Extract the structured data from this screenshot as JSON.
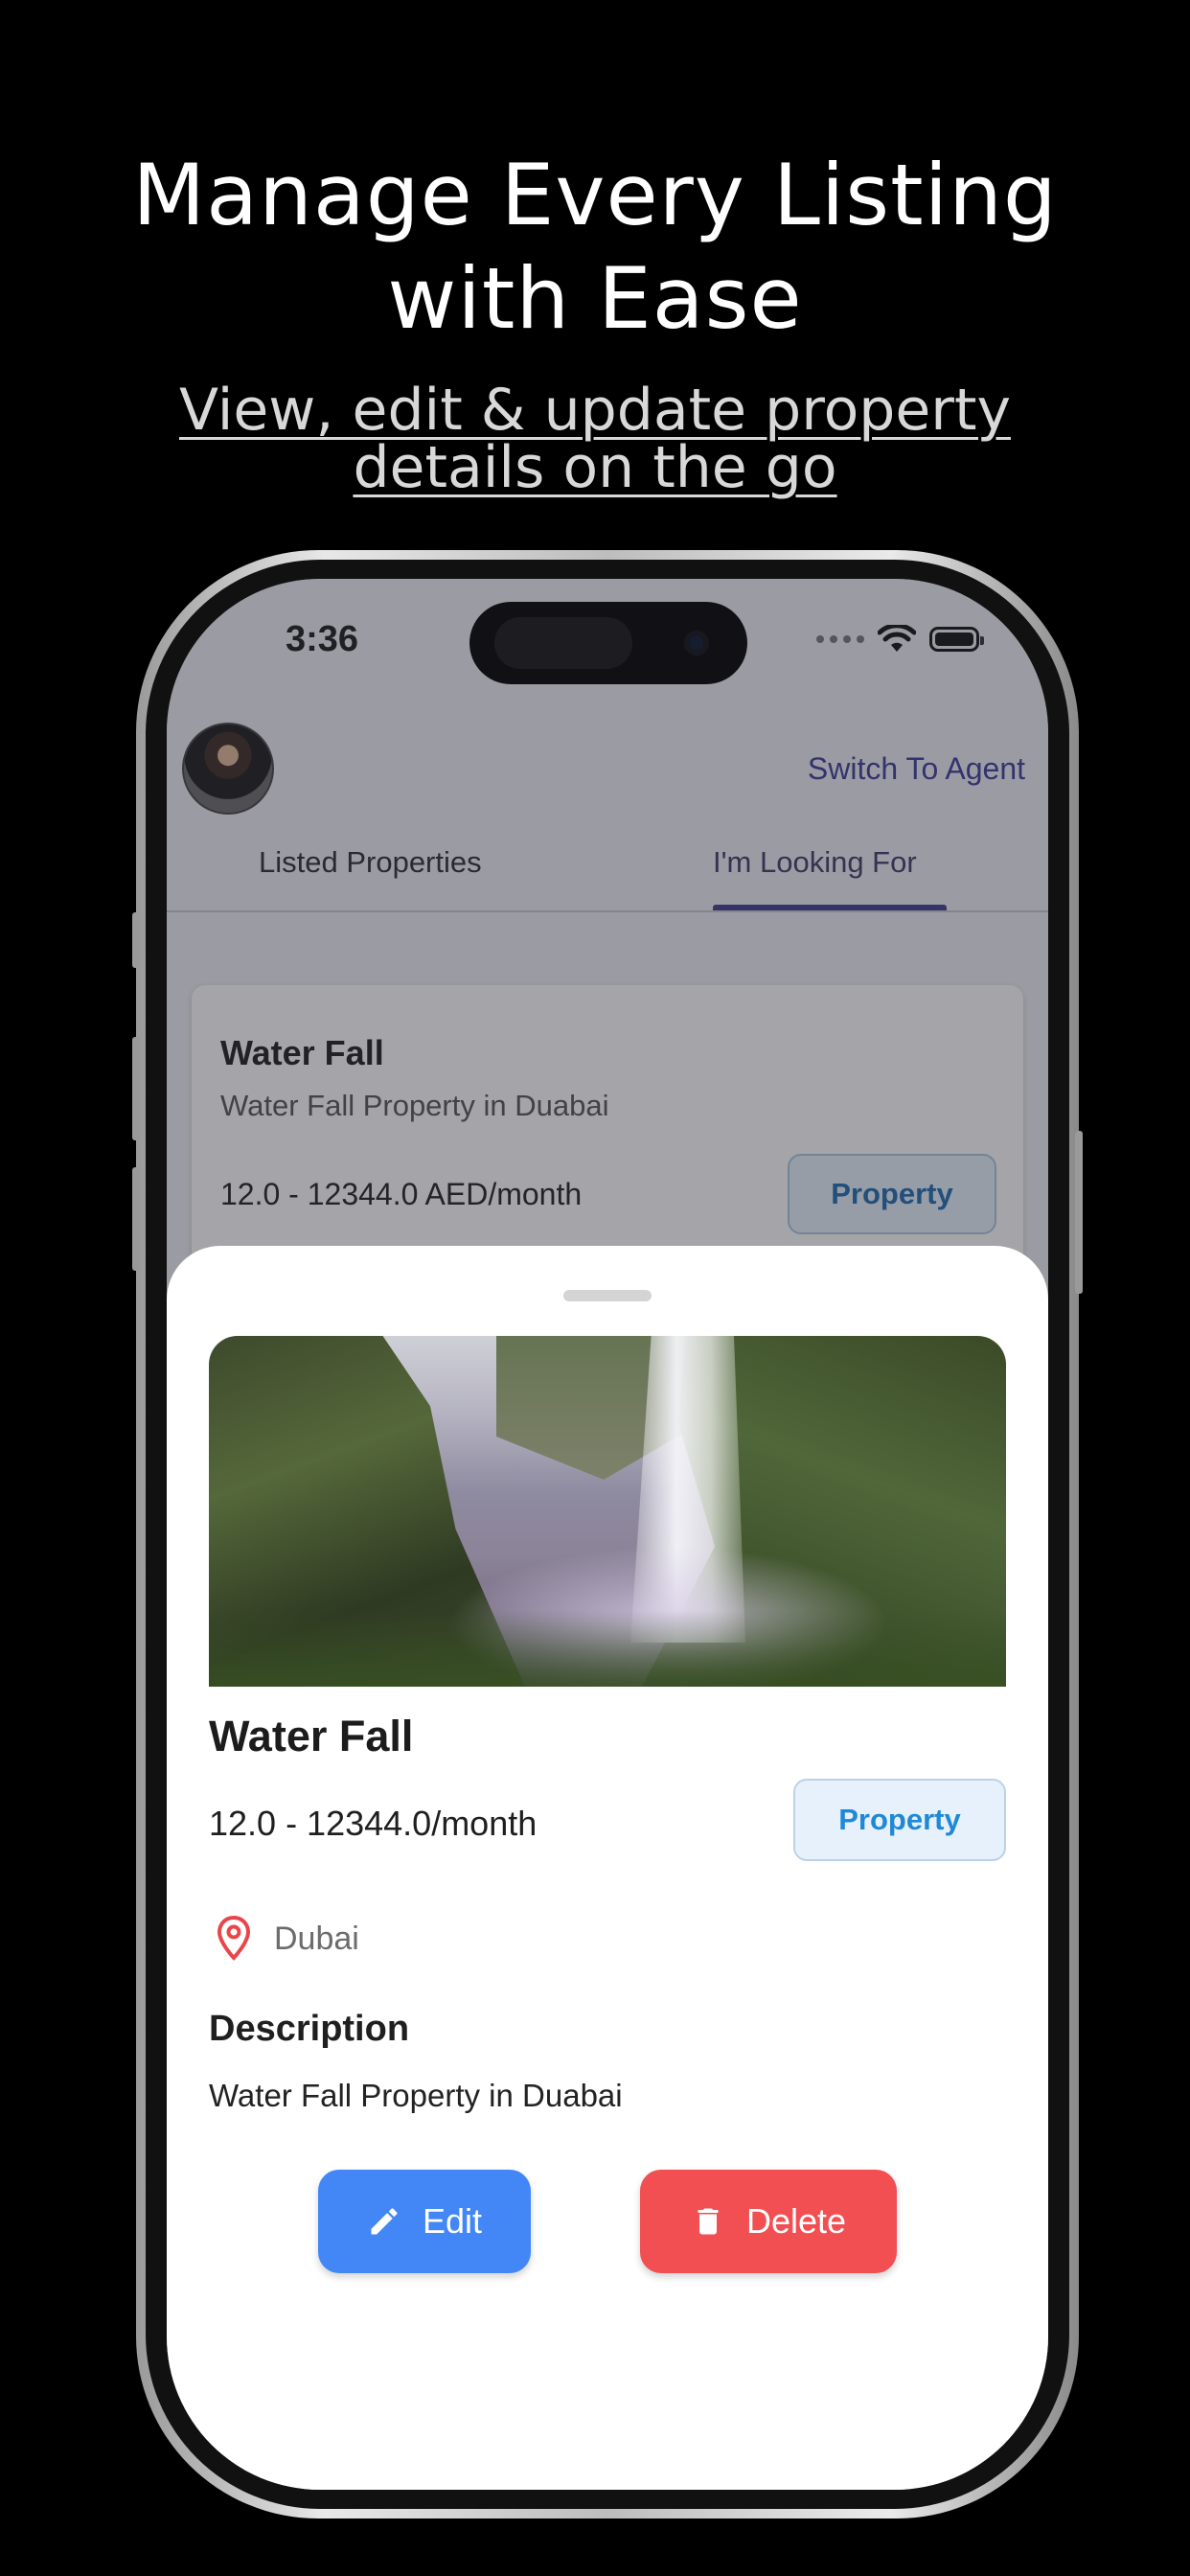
{
  "promo": {
    "headline_line1": "Manage Every Listing",
    "headline_line2": "with Ease",
    "subline_line1": "View, edit & update property",
    "subline_line2": "details on the go"
  },
  "status_bar": {
    "time": "3:36"
  },
  "header": {
    "switch_label": "Switch To Agent"
  },
  "tabs": [
    {
      "label": "Listed Properties",
      "active": false
    },
    {
      "label": "I'm Looking For",
      "active": true
    }
  ],
  "listing_card": {
    "title": "Water Fall",
    "subtitle": "Water Fall Property in Duabai",
    "price": "12.0 - 12344.0 AED/month",
    "badge": "Property"
  },
  "sheet": {
    "title": "Water Fall",
    "price": "12.0 - 12344.0/month",
    "badge": "Property",
    "location": "Dubai",
    "description_heading": "Description",
    "description": "Water Fall Property in Duabai",
    "edit_label": "Edit",
    "delete_label": "Delete"
  },
  "colors": {
    "edit_button": "#4287f5",
    "delete_button": "#f24f53",
    "badge_text": "#2089d6",
    "tab_indicator": "#3d3d8e",
    "location_pin": "#e9464a"
  },
  "icons": {
    "location": "location-pin-icon",
    "edit": "pencil-icon",
    "delete": "trash-icon",
    "wifi": "wifi-icon",
    "battery": "battery-icon"
  }
}
